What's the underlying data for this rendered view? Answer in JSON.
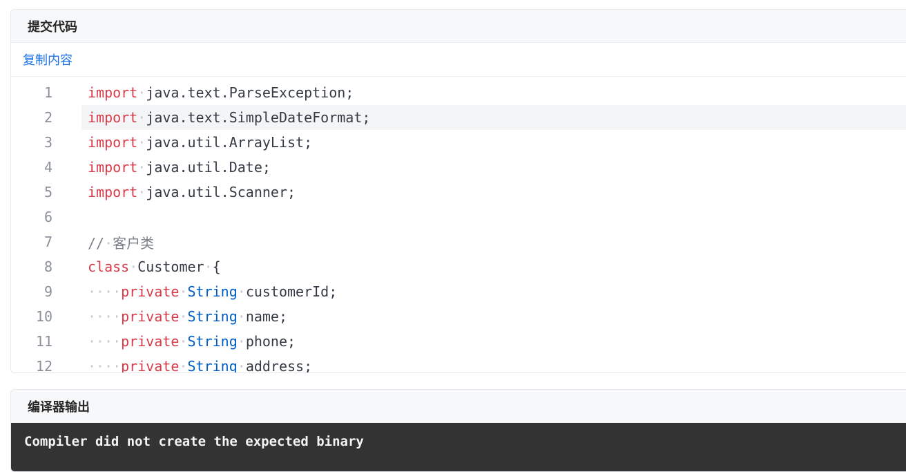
{
  "submit_panel": {
    "title": "提交代码",
    "copy_label": "复制内容",
    "active_line": 2,
    "lines": [
      {
        "num": "1",
        "tokens": [
          [
            "kw",
            "import"
          ],
          [
            "ws",
            "·"
          ],
          [
            "id",
            "java.text.ParseException;"
          ]
        ]
      },
      {
        "num": "2",
        "tokens": [
          [
            "kw",
            "import"
          ],
          [
            "ws",
            "·"
          ],
          [
            "id",
            "java.text.SimpleDateFormat;"
          ]
        ]
      },
      {
        "num": "3",
        "tokens": [
          [
            "kw",
            "import"
          ],
          [
            "ws",
            "·"
          ],
          [
            "id",
            "java.util.ArrayList;"
          ]
        ]
      },
      {
        "num": "4",
        "tokens": [
          [
            "kw",
            "import"
          ],
          [
            "ws",
            "·"
          ],
          [
            "id",
            "java.util.Date;"
          ]
        ]
      },
      {
        "num": "5",
        "tokens": [
          [
            "kw",
            "import"
          ],
          [
            "ws",
            "·"
          ],
          [
            "id",
            "java.util.Scanner;"
          ]
        ]
      },
      {
        "num": "6",
        "tokens": []
      },
      {
        "num": "7",
        "tokens": [
          [
            "comment",
            "//"
          ],
          [
            "ws",
            "·"
          ],
          [
            "comment",
            "客户类"
          ]
        ]
      },
      {
        "num": "8",
        "tokens": [
          [
            "kw",
            "class"
          ],
          [
            "ws",
            "·"
          ],
          [
            "id",
            "Customer"
          ],
          [
            "ws",
            "·"
          ],
          [
            "id",
            "{"
          ]
        ]
      },
      {
        "num": "9",
        "tokens": [
          [
            "ws",
            "····"
          ],
          [
            "kw",
            "private"
          ],
          [
            "ws",
            "·"
          ],
          [
            "type",
            "String"
          ],
          [
            "ws",
            "·"
          ],
          [
            "id",
            "customerId;"
          ]
        ]
      },
      {
        "num": "10",
        "tokens": [
          [
            "ws",
            "····"
          ],
          [
            "kw",
            "private"
          ],
          [
            "ws",
            "·"
          ],
          [
            "type",
            "String"
          ],
          [
            "ws",
            "·"
          ],
          [
            "id",
            "name;"
          ]
        ]
      },
      {
        "num": "11",
        "tokens": [
          [
            "ws",
            "····"
          ],
          [
            "kw",
            "private"
          ],
          [
            "ws",
            "·"
          ],
          [
            "type",
            "String"
          ],
          [
            "ws",
            "·"
          ],
          [
            "id",
            "phone;"
          ]
        ]
      },
      {
        "num": "12",
        "tokens": [
          [
            "ws",
            "····"
          ],
          [
            "kw",
            "private"
          ],
          [
            "ws",
            "·"
          ],
          [
            "type",
            "String"
          ],
          [
            "ws",
            "·"
          ],
          [
            "id",
            "address;"
          ]
        ]
      }
    ]
  },
  "output_panel": {
    "title": "编译器输出",
    "message": "Compiler did not create the expected binary"
  },
  "colors": {
    "keyword": "#d73a49",
    "type": "#005cc5",
    "link": "#1a73e8",
    "output_bg": "#333333"
  }
}
